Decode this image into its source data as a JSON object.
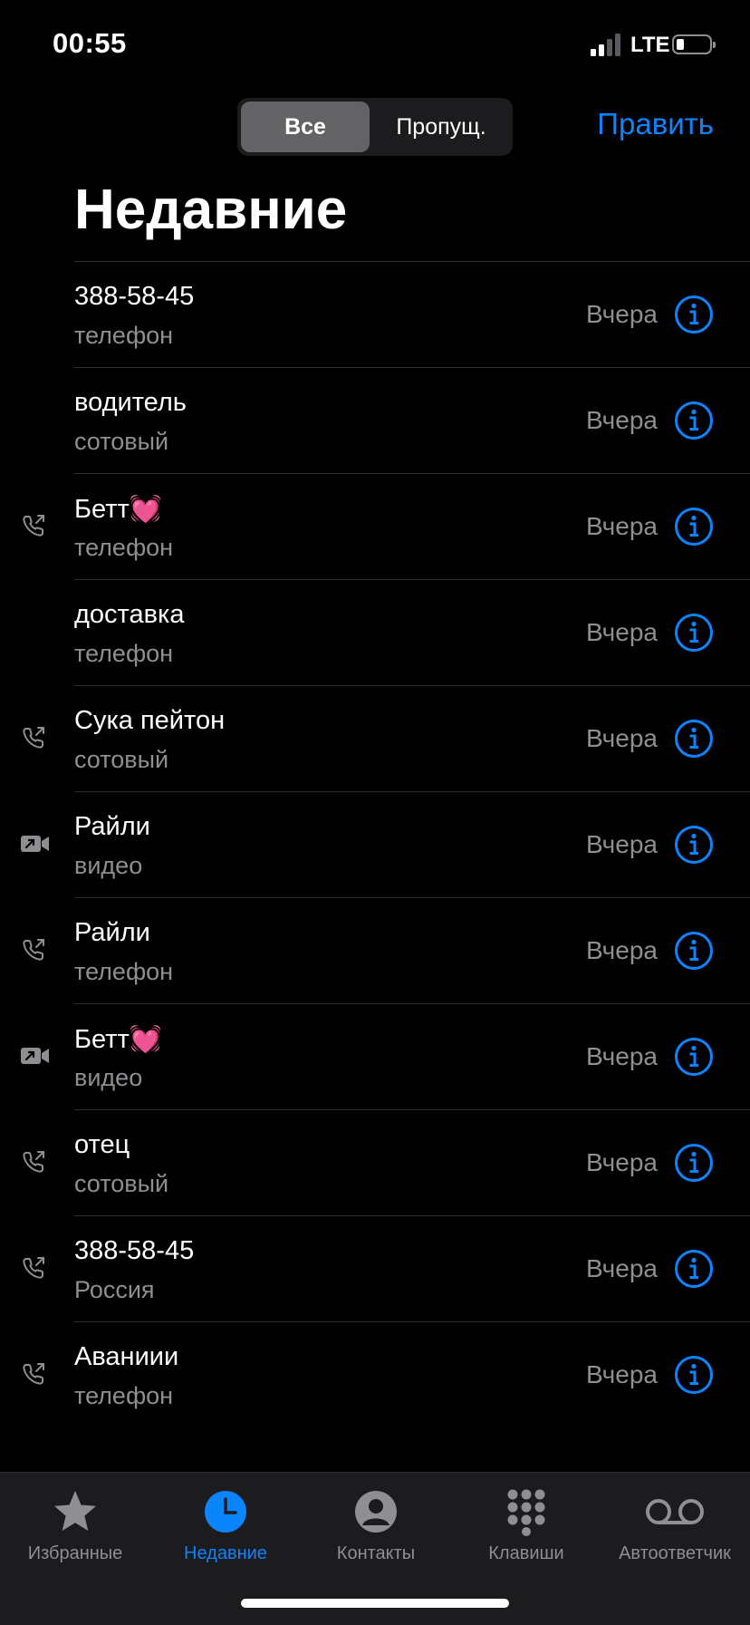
{
  "status_bar": {
    "time": "00:55",
    "network": "LTE"
  },
  "segmented_control": {
    "all": "Все",
    "missed": "Пропущ."
  },
  "header": {
    "edit": "Править",
    "title": "Недавние"
  },
  "calls": [
    {
      "name": "388-58-45",
      "label": "телефон",
      "date": "Вчера",
      "icon": "none"
    },
    {
      "name": "водитель",
      "label": "сотовый",
      "date": "Вчера",
      "icon": "none"
    },
    {
      "name": "Бетт💓",
      "label": "телефон",
      "date": "Вчера",
      "icon": "phone-outgoing-icon"
    },
    {
      "name": "доставка",
      "label": "телефон",
      "date": "Вчера",
      "icon": "none"
    },
    {
      "name": "Сука пейтон",
      "label": "сотовый",
      "date": "Вчера",
      "icon": "phone-outgoing-icon"
    },
    {
      "name": "Райли",
      "label": "видео",
      "date": "Вчера",
      "icon": "video-outgoing-icon"
    },
    {
      "name": "Райли",
      "label": "телефон",
      "date": "Вчера",
      "icon": "phone-outgoing-icon"
    },
    {
      "name": "Бетт💓",
      "label": "видео",
      "date": "Вчера",
      "icon": "video-outgoing-icon"
    },
    {
      "name": "отец",
      "label": "сотовый",
      "date": "Вчера",
      "icon": "phone-outgoing-icon"
    },
    {
      "name": "388-58-45",
      "label": "Россия",
      "date": "Вчера",
      "icon": "phone-outgoing-icon"
    },
    {
      "name": "Аваниии",
      "label": "телефон",
      "date": "Вчера",
      "icon": "phone-outgoing-icon"
    }
  ],
  "tab_bar": {
    "favorites": "Избранные",
    "recents": "Недавние",
    "contacts": "Контакты",
    "keypad": "Клавиши",
    "voicemail": "Автоответчик"
  },
  "colors": {
    "accent": "#0a84ff",
    "background": "#000000",
    "secondary_text": "#8e8e93"
  }
}
